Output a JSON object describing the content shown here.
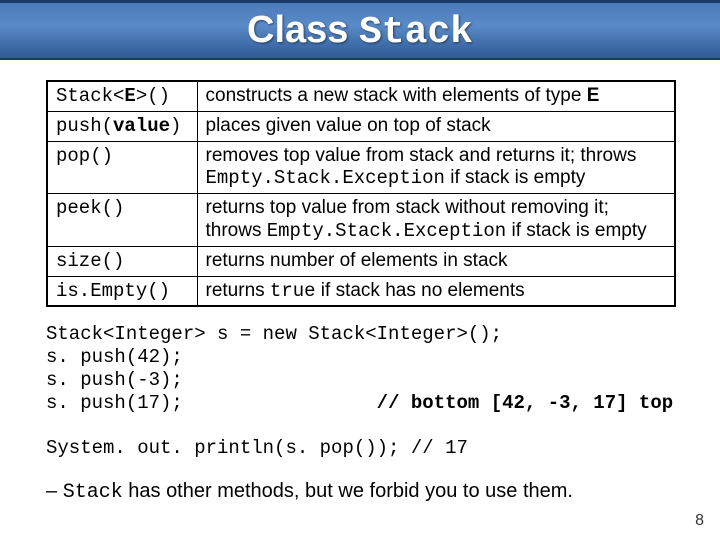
{
  "header": {
    "title_sans": "Class ",
    "title_mono": "Stack"
  },
  "table": {
    "rows": [
      {
        "method_html": "Stack<<b>E</b>>()",
        "desc_html": "constructs a new stack with elements of type <b>E</b>"
      },
      {
        "method_html": "push(<b>value</b>)",
        "desc_html": "places given value on top of stack"
      },
      {
        "method_html": "pop()",
        "desc_html": "removes top value from stack and returns it; throws <span class=\"mono\">Empty.Stack.Exception</span> if stack is empty"
      },
      {
        "method_html": "peek()",
        "desc_html": "returns top value from stack without removing it; throws <span class=\"mono\">Empty.Stack.Exception</span> if stack is empty"
      },
      {
        "method_html": "size()",
        "desc_html": "returns number of elements in stack"
      },
      {
        "method_html": "is.Empty()",
        "desc_html": "returns <span class=\"mono\">true</span> if stack has no elements"
      }
    ]
  },
  "code": {
    "line1": "Stack<Integer> s = new Stack<Integer>();",
    "line2": "s. push(42);",
    "line3": "s. push(-3);",
    "line4a": "s. push(17);",
    "line4b": "// bottom [42, -3, 17] top",
    "line5": "System. out. println(s. pop()); // 17"
  },
  "note": {
    "dash": "– ",
    "mono": "Stack",
    "rest": " has other methods, but we forbid you to use them."
  },
  "pagenum": "8"
}
